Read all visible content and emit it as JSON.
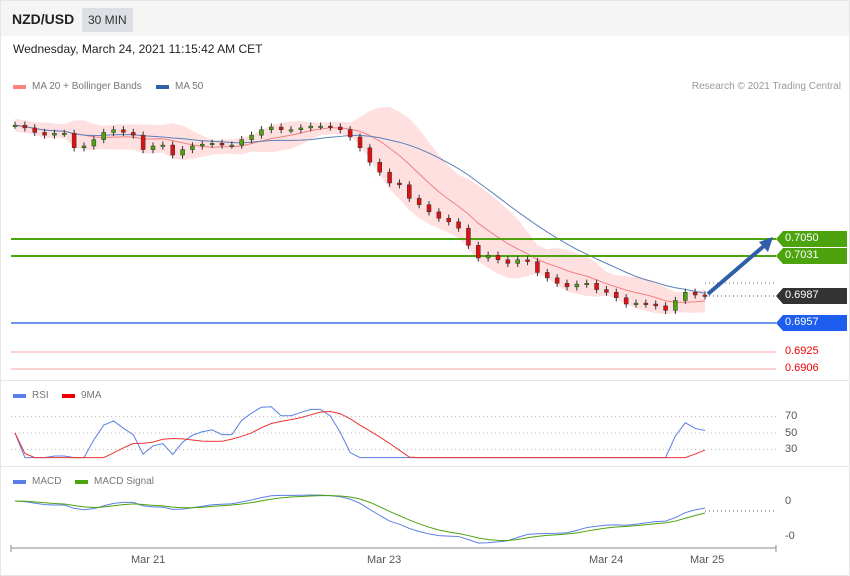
{
  "header": {
    "symbol": "NZD/USD",
    "timeframe": "30 MIN"
  },
  "date": "Wednesday, March 24, 2021 11:15:42 AM CET",
  "legend": {
    "ma20": "MA 20 + Bollinger Bands",
    "ma50": "MA 50",
    "rsi": "RSI",
    "rsi_ma": "9MA",
    "macd": "MACD",
    "macd_signal": "MACD Signal"
  },
  "copyright": "Research © 2021 Trading Central",
  "levels": {
    "r2": "0.7050",
    "r1": "0.7031",
    "last": "0.6987",
    "pivot": "0.6957",
    "s1": "0.6925",
    "s2": "0.6906"
  },
  "colors": {
    "resistance": "#4ca30d",
    "pivot": "#1e5eef",
    "support": "#e02020",
    "last": "#333333",
    "ma50": "#2e5fa8",
    "bands": "#ffd9d9"
  },
  "rsi_axis": [
    "70",
    "50",
    "30"
  ],
  "macd_axis": [
    "0",
    "-0"
  ],
  "x_axis": [
    "Mar 21",
    "Mar 23",
    "Mar 24",
    "Mar 25"
  ],
  "chart_data": {
    "type": "candlestick",
    "closes": [
      0.7176,
      0.7173,
      0.7168,
      0.7165,
      0.7167,
      0.7167,
      0.7151,
      0.7153,
      0.716,
      0.7168,
      0.7171,
      0.7168,
      0.7165,
      0.7149,
      0.7153,
      0.7154,
      0.7143,
      0.7149,
      0.7153,
      0.7155,
      0.7156,
      0.7154,
      0.7154,
      0.716,
      0.7165,
      0.7171,
      0.7174,
      0.7171,
      0.7171,
      0.7173,
      0.7175,
      0.7175,
      0.7174,
      0.7171,
      0.7163,
      0.7151,
      0.7135,
      0.7124,
      0.7112,
      0.711,
      0.7095,
      0.7088,
      0.708,
      0.7073,
      0.7069,
      0.7062,
      0.7043,
      0.7029,
      0.7032,
      0.7027,
      0.7023,
      0.7027,
      0.7025,
      0.7013,
      0.7007,
      0.7001,
      0.6997,
      0.7,
      0.7001,
      0.6994,
      0.6991,
      0.6985,
      0.6978,
      0.6979,
      0.6978,
      0.6976,
      0.6971,
      0.6982,
      0.6991,
      0.6988,
      0.6987
    ]
  }
}
